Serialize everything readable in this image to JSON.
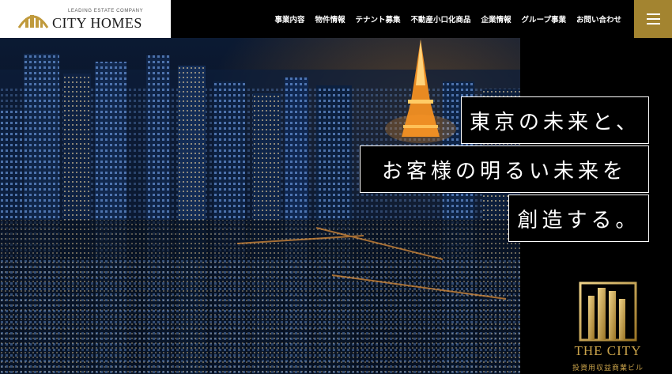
{
  "header": {
    "logo_sub": "LEADING ESTATE COMPANY",
    "logo_name": "CITY HOMES",
    "nav": [
      "事業内容",
      "物件情報",
      "テナント募集",
      "不動産小口化商品",
      "企業情報",
      "グループ事業",
      "お問い合わせ"
    ]
  },
  "hero": {
    "copy": [
      "東京の未来と、",
      "お客様の明るい未来を",
      "創造する。"
    ],
    "badge_name": "THE CITY",
    "badge_sub": "投資用収益商業ビル"
  },
  "colors": {
    "gold": "#a38430",
    "badge_gold": "#c9a24a",
    "background": "#000000"
  },
  "icons": [
    "logo-building-icon",
    "hamburger-menu-icon",
    "the-city-building-icon"
  ]
}
